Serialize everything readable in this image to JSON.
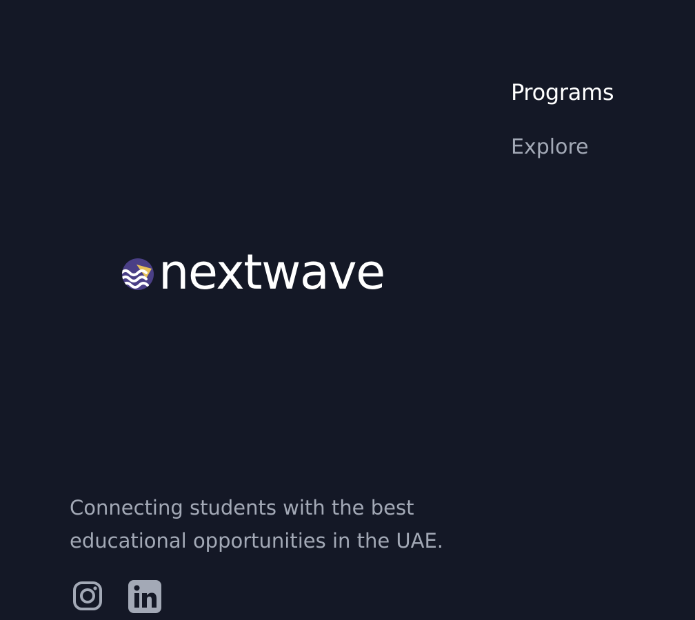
{
  "nav": {
    "heading": "Programs",
    "links": [
      {
        "label": "Explore"
      }
    ]
  },
  "brand": {
    "name": "nextwave",
    "logo_icon": "wave-logo-icon",
    "colors": {
      "mark_bg": "#4a3f86",
      "mark_accent": "#e8c25a",
      "mark_waves": "#ffffff"
    }
  },
  "tagline": {
    "line1": "Connecting students with the best",
    "line2": "educational opportunities in the UAE."
  },
  "social": [
    {
      "name": "instagram-icon",
      "label": "Instagram"
    },
    {
      "name": "linkedin-icon",
      "label": "LinkedIn"
    }
  ],
  "theme": {
    "background": "#141826",
    "text_primary": "#ffffff",
    "text_muted": "#a3a9b6"
  }
}
